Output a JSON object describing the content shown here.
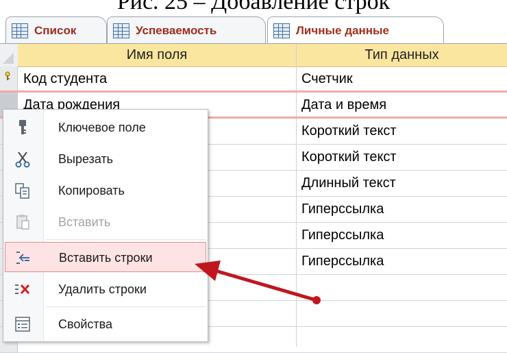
{
  "caption": "Рис. 25 – Добавление строк",
  "tabs": [
    {
      "label": "Список",
      "active": false,
      "icon": "table-icon"
    },
    {
      "label": "Успеваемость",
      "active": false,
      "icon": "table-icon"
    },
    {
      "label": "Личные данные",
      "active": true,
      "icon": "table-icon"
    }
  ],
  "grid": {
    "headers": {
      "field_name": "Имя поля",
      "data_type": "Тип данных"
    },
    "rows": [
      {
        "field": "Код студента",
        "type": "Счетчик",
        "primary_key": true
      },
      {
        "field": "Дата рождения",
        "type": "Дата и время"
      },
      {
        "field": "",
        "type": "Короткий текст"
      },
      {
        "field": "",
        "type": "Короткий текст"
      },
      {
        "field": "",
        "type": "Длинный текст"
      },
      {
        "field": "",
        "type": "Гиперссылка"
      },
      {
        "field": "",
        "type": "Гиперссылка"
      },
      {
        "field": "",
        "type": "Гиперссылка"
      },
      {
        "field": "",
        "type": ""
      },
      {
        "field": "",
        "type": ""
      },
      {
        "field": "",
        "type": ""
      },
      {
        "field": "",
        "type": ""
      }
    ]
  },
  "context_menu": {
    "items": [
      {
        "label": "Ключевое поле",
        "icon": "key-icon",
        "disabled": false
      },
      {
        "label": "Вырезать",
        "icon": "scissors-icon",
        "disabled": false
      },
      {
        "label": "Копировать",
        "icon": "copy-icon",
        "disabled": false
      },
      {
        "label": "Вставить",
        "icon": "paste-icon",
        "disabled": true
      },
      {
        "label": "Вставить строки",
        "icon": "insert-rows-icon",
        "disabled": false,
        "highlighted": true
      },
      {
        "label": "Удалить строки",
        "icon": "delete-rows-icon",
        "disabled": false
      },
      {
        "label": "Свойства",
        "icon": "properties-icon",
        "disabled": false
      }
    ]
  },
  "colors": {
    "header_bg": "#fbe6a0",
    "tab_text": "#a0301e",
    "highlight_bg": "#fde3e3",
    "highlight_border": "#e78a8a",
    "arrow": "#c0171e"
  }
}
